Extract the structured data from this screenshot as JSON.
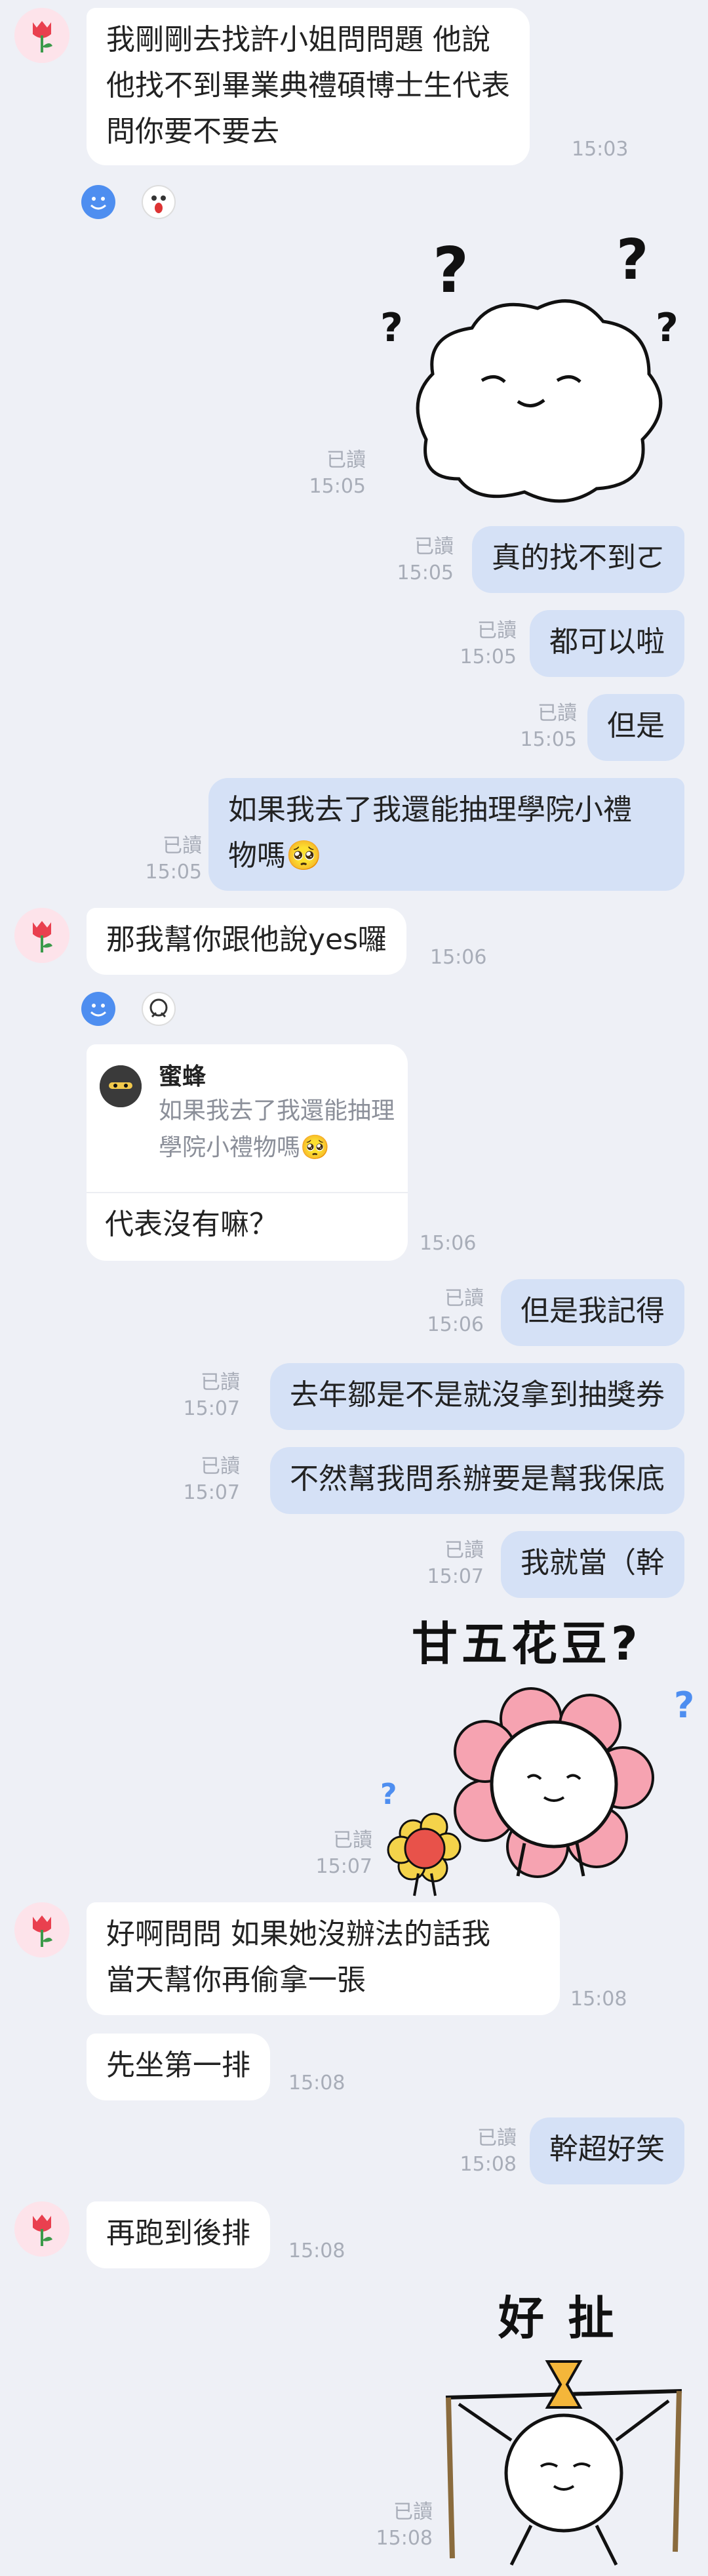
{
  "messages": {
    "m1": {
      "lines": [
        "我剛剛去找許小姐問問題 他說",
        "他找不到畢業典禮碩博士生代表",
        "問你要不要去"
      ],
      "time": "15:03"
    },
    "sticker1": {
      "read": "已讀",
      "time": "15:05"
    },
    "m2": {
      "text": "真的找不到ㄛ",
      "read": "已讀",
      "time": "15:05"
    },
    "m3": {
      "text": "都可以啦",
      "read": "已讀",
      "time": "15:05"
    },
    "m4": {
      "text": "但是",
      "read": "已讀",
      "time": "15:05"
    },
    "m5": {
      "lines": [
        "如果我去了我還能抽理學院小禮",
        "物嗎🥺"
      ],
      "read": "已讀",
      "time": "15:05"
    },
    "m6": {
      "text": "那我幫你跟他說yes囉",
      "time": "15:06"
    },
    "m7": {
      "reply_name": "蜜蜂",
      "reply_quote": "如果我去了我還能抽理學院小禮物嗎🥺",
      "text": "代表沒有嘛？",
      "time": "15:06"
    },
    "m8": {
      "text": "但是我記得",
      "read": "已讀",
      "time": "15:06"
    },
    "m9": {
      "text": "去年鄒是不是就沒拿到抽獎券",
      "read": "已讀",
      "time": "15:07"
    },
    "m10": {
      "text": "不然幫我問系辦要是幫我保底",
      "read": "已讀",
      "time": "15:07"
    },
    "m11": {
      "text": "我就當（幹",
      "read": "已讀",
      "time": "15:07"
    },
    "sticker2": {
      "caption": "甘五花豆?",
      "read": "已讀",
      "time": "15:07"
    },
    "m12": {
      "lines": [
        "好啊問問 如果她沒辦法的話我",
        "當天幫你再偷拿一張"
      ],
      "time": "15:08"
    },
    "m13": {
      "text": "先坐第一排",
      "time": "15:08"
    },
    "m14": {
      "text": "幹超好笑",
      "read": "已讀",
      "time": "15:08"
    },
    "m15": {
      "text": "再跑到後排",
      "time": "15:08"
    },
    "sticker3": {
      "caption": "好 扯",
      "read": "已讀",
      "time": "15:08"
    }
  },
  "colors": {
    "background": "#eef0f6",
    "incoming": "#ffffff",
    "outgoing": "#d5e1f6",
    "timestamp": "#a8adb8"
  }
}
